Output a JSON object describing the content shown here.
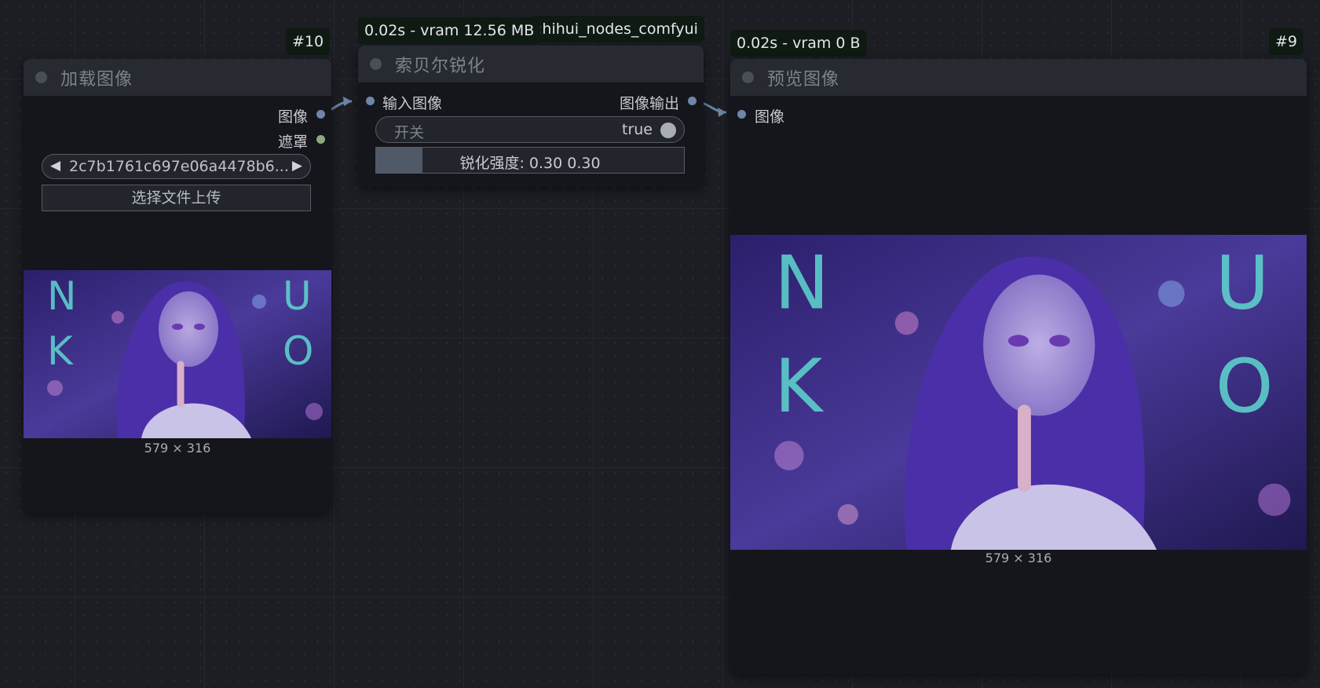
{
  "nodes": {
    "load_image": {
      "id_badge": "#10",
      "title": "加载图像",
      "outputs": [
        "图像",
        "遮罩"
      ],
      "file_combo": {
        "prev": "◀",
        "value": "2c7b1761c697e06a4478b6...",
        "next": "▶"
      },
      "upload_button": "选择文件上传",
      "image_size": "579 × 316"
    },
    "sobel_sharpen": {
      "timing_badge": "0.02s - vram 12.56 MB",
      "source_badge": ":hihui_nodes_comfyui",
      "title": "索贝尔锐化",
      "input": "输入图像",
      "output": "图像输出",
      "toggle": {
        "label": "开关",
        "value": "true"
      },
      "slider": {
        "text": "锐化强度: 0.30  0.30",
        "fill_fraction": 0.15
      }
    },
    "preview_image": {
      "timing_badge": "0.02s - vram 0 B",
      "id_badge": "#9",
      "title": "预览图像",
      "input": "图像",
      "image_size": "579 × 316"
    }
  },
  "colors": {
    "canvas_bg": "#1c1e24",
    "node_bg": "#14161b",
    "node_header": "#272a31",
    "image_slot": "#6f86a8",
    "mask_slot": "#8da981",
    "badge_bg": "#0e1a12"
  },
  "icons": {
    "image_thumb": "anime-girl-neon-city-image",
    "preview": "anime-girl-neon-city-image"
  }
}
